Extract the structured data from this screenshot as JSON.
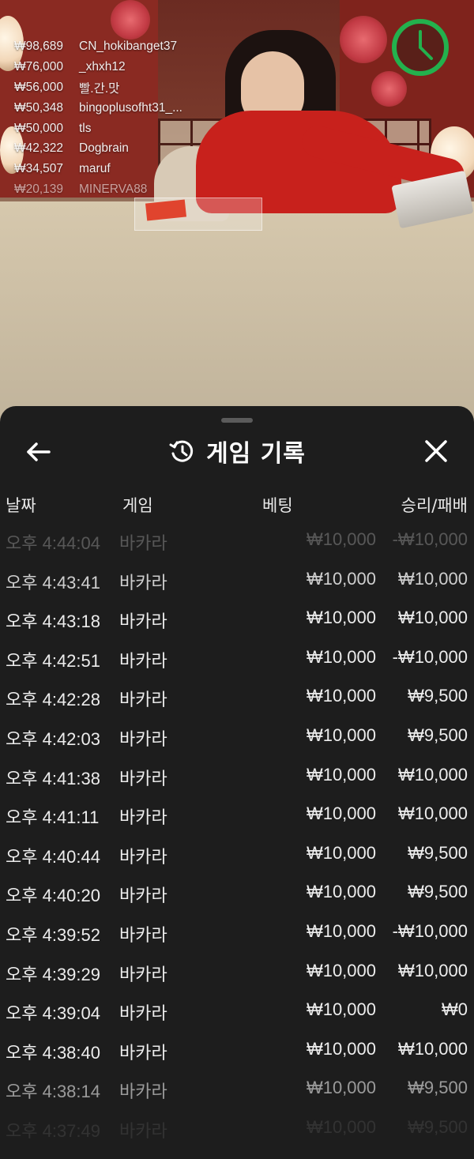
{
  "leaderboard": [
    {
      "amount": "₩98,689",
      "user": "CN_hokibanget37"
    },
    {
      "amount": "₩76,000",
      "user": "_xhxh12"
    },
    {
      "amount": "₩56,000",
      "user": "빨.간.맛"
    },
    {
      "amount": "₩50,348",
      "user": "bingoplusofht31_..."
    },
    {
      "amount": "₩50,000",
      "user": "tls"
    },
    {
      "amount": "₩42,322",
      "user": "Dogbrain"
    },
    {
      "amount": "₩34,507",
      "user": "maruf"
    },
    {
      "amount": "₩20,139",
      "user": "MINERVA88"
    }
  ],
  "sheet": {
    "title": "게임 기록",
    "icons": {
      "back": "arrow-left-icon",
      "history": "history-icon",
      "close": "close-icon"
    },
    "columns": {
      "date": "날짜",
      "game": "게임",
      "bet": "베팅",
      "result": "승리/패배"
    },
    "rows": [
      {
        "time": "오후 4:44:04",
        "game": "바카라",
        "bet": "₩10,000",
        "result": "-₩10,000"
      },
      {
        "time": "오후 4:43:41",
        "game": "바카라",
        "bet": "₩10,000",
        "result": "₩10,000"
      },
      {
        "time": "오후 4:43:18",
        "game": "바카라",
        "bet": "₩10,000",
        "result": "₩10,000"
      },
      {
        "time": "오후 4:42:51",
        "game": "바카라",
        "bet": "₩10,000",
        "result": "-₩10,000"
      },
      {
        "time": "오후 4:42:28",
        "game": "바카라",
        "bet": "₩10,000",
        "result": "₩9,500"
      },
      {
        "time": "오후 4:42:03",
        "game": "바카라",
        "bet": "₩10,000",
        "result": "₩9,500"
      },
      {
        "time": "오후 4:41:38",
        "game": "바카라",
        "bet": "₩10,000",
        "result": "₩10,000"
      },
      {
        "time": "오후 4:41:11",
        "game": "바카라",
        "bet": "₩10,000",
        "result": "₩10,000"
      },
      {
        "time": "오후 4:40:44",
        "game": "바카라",
        "bet": "₩10,000",
        "result": "₩9,500"
      },
      {
        "time": "오후 4:40:20",
        "game": "바카라",
        "bet": "₩10,000",
        "result": "₩9,500"
      },
      {
        "time": "오후 4:39:52",
        "game": "바카라",
        "bet": "₩10,000",
        "result": "-₩10,000"
      },
      {
        "time": "오후 4:39:29",
        "game": "바카라",
        "bet": "₩10,000",
        "result": "₩10,000"
      },
      {
        "time": "오후 4:39:04",
        "game": "바카라",
        "bet": "₩10,000",
        "result": "₩0"
      },
      {
        "time": "오후 4:38:40",
        "game": "바카라",
        "bet": "₩10,000",
        "result": "₩10,000"
      },
      {
        "time": "오후 4:38:14",
        "game": "바카라",
        "bet": "₩10,000",
        "result": "₩9,500"
      },
      {
        "time": "오후 4:37:49",
        "game": "바카라",
        "bet": "₩10,000",
        "result": "₩9,500"
      }
    ]
  },
  "colors": {
    "timer": "#23b14d",
    "sheet_bg": "#1d1d1d",
    "text": "#ededed"
  }
}
